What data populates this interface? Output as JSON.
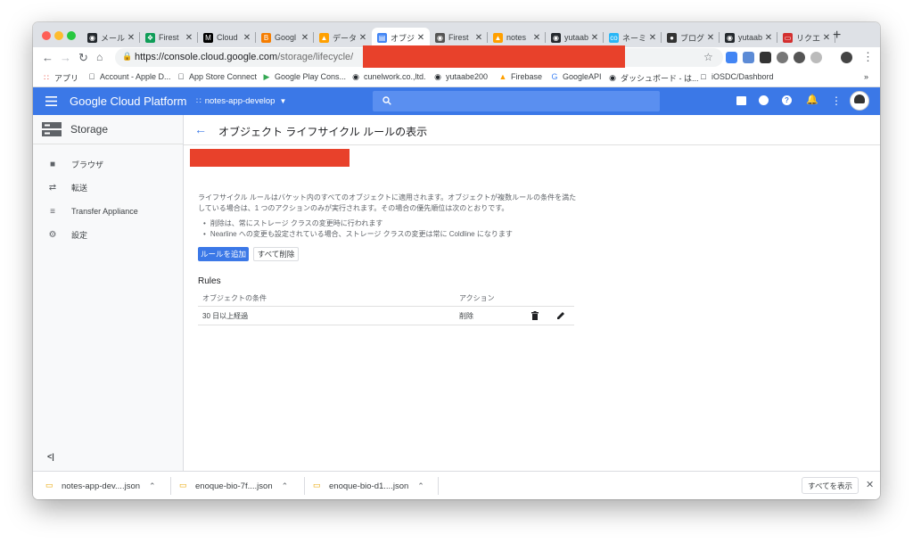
{
  "browser": {
    "tabs": [
      {
        "title": "メール",
        "icon": "github-icon",
        "color": "#24292e"
      },
      {
        "title": "Firest",
        "icon": "hangouts-icon",
        "color": "#0f9d58"
      },
      {
        "title": "Cloud",
        "icon": "medium-icon",
        "color": "#000000"
      },
      {
        "title": "Googl",
        "icon": "blogger-icon",
        "color": "#f57d00"
      },
      {
        "title": "データ",
        "icon": "firebase-icon",
        "color": "#ffa000"
      },
      {
        "title": "オブジ",
        "icon": "gcp-storage-icon",
        "color": "#4285f4"
      },
      {
        "title": "Firest",
        "icon": "avatar-icon",
        "color": "#555555"
      },
      {
        "title": "notes",
        "icon": "firebase-icon",
        "color": "#ffa000"
      },
      {
        "title": "yutaab",
        "icon": "github-icon",
        "color": "#24292e"
      },
      {
        "title": "ネーミ",
        "icon": "codic-icon",
        "color": "#29b6f6"
      },
      {
        "title": "ブログ",
        "icon": "hatena-icon",
        "color": "#333333"
      },
      {
        "title": "yutaab",
        "icon": "github-icon",
        "color": "#24292e"
      },
      {
        "title": "リクエ",
        "icon": "recruit-icon",
        "color": "#d32f2f"
      }
    ],
    "active_tab": 5,
    "url_host": "https://console.cloud.google.com",
    "url_path": "/storage/lifecycle/",
    "bookmarks": [
      {
        "label": "アプリ",
        "icon": "apps-grid-icon"
      },
      {
        "label": "Account - Apple D...",
        "icon": "apple-icon"
      },
      {
        "label": "App Store Connect",
        "icon": "apple-icon"
      },
      {
        "label": "Google Play Cons...",
        "icon": "google-play-icon"
      },
      {
        "label": "cunelwork.co.,ltd.",
        "icon": "github-icon"
      },
      {
        "label": "yutaabe200",
        "icon": "github-icon"
      },
      {
        "label": "Firebase",
        "icon": "firebase-icon"
      },
      {
        "label": "GoogleAPI",
        "icon": "google-icon"
      },
      {
        "label": "ダッシュボード - は...",
        "icon": "hatena-icon"
      },
      {
        "label": "iOSDC/Dashbord",
        "icon": "page-icon"
      }
    ],
    "bookmarks_more": "»"
  },
  "gcp": {
    "title": "Google Cloud Platform",
    "project": "notes-app-develop",
    "header_color": "#3b78e7"
  },
  "sidebar": {
    "title": "Storage",
    "items": [
      {
        "label": "ブラウザ",
        "icon": "bucket-icon"
      },
      {
        "label": "転送",
        "icon": "transfer-icon"
      },
      {
        "label": "Transfer Appliance",
        "icon": "appliance-icon"
      },
      {
        "label": "設定",
        "icon": "gear-icon"
      }
    ],
    "collapse": "<|"
  },
  "main": {
    "title": "オブジェクト ライフサイクル ルールの表示",
    "description_line1": "ライフサイクル ルールはバケット内のすべてのオブジェクトに適用されます。オブジェクトが複数ルールの条件を満た",
    "description_line2": "している場合は、1 つのアクションのみが実行されます。その場合の優先順位は次のとおりです。",
    "bullets": [
      "削除は、常にストレージ クラスの変更時に行われます",
      "Nearline への変更も設定されている場合、ストレージ クラスの変更は常に Coldline になります"
    ],
    "add_rule_button": "ルールを追加",
    "delete_all_button": "すべて削除",
    "rules_heading": "Rules",
    "rules_columns": [
      "オブジェクトの条件",
      "アクション"
    ],
    "rules": [
      {
        "condition": "30 日以上経過",
        "action": "削除"
      }
    ]
  },
  "downloads": {
    "items": [
      {
        "name": "notes-app-dev....json"
      },
      {
        "name": "enoque-bio-7f....json"
      },
      {
        "name": "enoque-bio-d1....json"
      }
    ],
    "show_all": "すべてを表示"
  }
}
